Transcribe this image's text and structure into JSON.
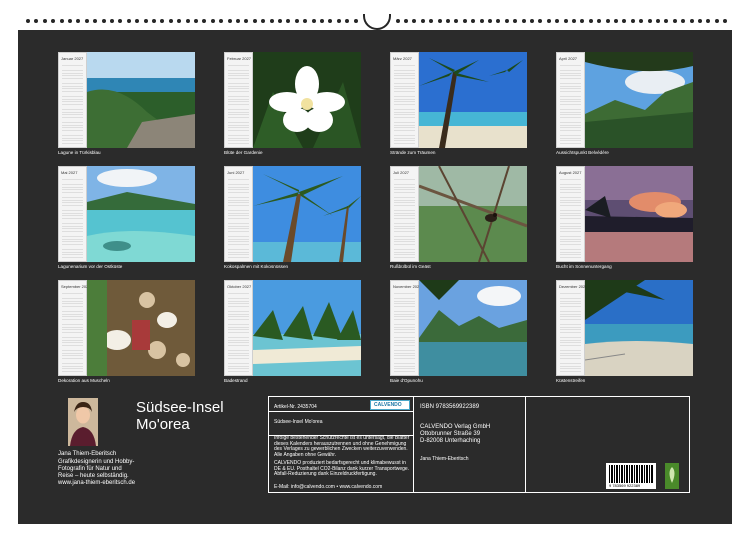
{
  "tiles": [
    {
      "month": "Januar 2027",
      "caption": "Lagune in Türkisblau"
    },
    {
      "month": "Februar 2027",
      "caption": "Blüte der Gardenie"
    },
    {
      "month": "März 2027",
      "caption": "Strände zum Träumen"
    },
    {
      "month": "April 2027",
      "caption": "Aussichtspunkt Belvédère"
    },
    {
      "month": "Mai 2027",
      "caption": "Lagunenarium vor der Ostküste"
    },
    {
      "month": "Juni 2027",
      "caption": "Kokospalmen mit Kokosnüssen"
    },
    {
      "month": "Juli 2027",
      "caption": "Rußbülbül im Geäst"
    },
    {
      "month": "August 2027",
      "caption": "Bucht im Sonnenuntergang"
    },
    {
      "month": "September 2027",
      "caption": "Dekoration aus Muscheln"
    },
    {
      "month": "Oktober 2027",
      "caption": "Badestrand"
    },
    {
      "month": "November 2027",
      "caption": "Baie d'Opunohu"
    },
    {
      "month": "Dezember 2027",
      "caption": "Küstenstreifen"
    }
  ],
  "title_line1": "Südsee-Insel",
  "title_line2": "Mo'orea",
  "author": {
    "name": "Jana Thiem-Eberitsch",
    "bio": "Grafikdesignerin und Hobby-Fotografin für Natur und Reise – heute selbständig. www.jana-thiem-eberitsch.de"
  },
  "info": {
    "article": "Artikel-Nr. 2435704",
    "logo": "CALVENDO",
    "subtitle": "Südsee-Insel Mo'orea",
    "legal": "Infolge bestehender Schutzrechte ist es untersagt, die Blätter dieses Kalenders herauszutrennen und ohne Genehmigung des Verlages zu gewerblichen Zwecken weiterzuverwenden. Alle Angaben ohne Gewähr.",
    "eco": "CALVENDO produziert bedarfsgerecht und klimabewusst in DE & EU. Posthaltel CO2-Bilanz dank kurzer Transportwege. Abfall-Reduzierung dank Einzeldruckfertigung.",
    "contact": "E-Mail: info@calvendo.com • www.calvendo.com",
    "isbn": "ISBN 9783569922389",
    "publisher": "CALVENDO Verlag GmbH",
    "street": "Ottobrunner Straße 39",
    "city": "D-82008 Unterhaching",
    "author_small": "Jana Thiem-Eberitsch",
    "barcode": "9 783569 922389"
  },
  "colors": {
    "sheet": "#2b2b2b",
    "text": "#ffffff"
  }
}
